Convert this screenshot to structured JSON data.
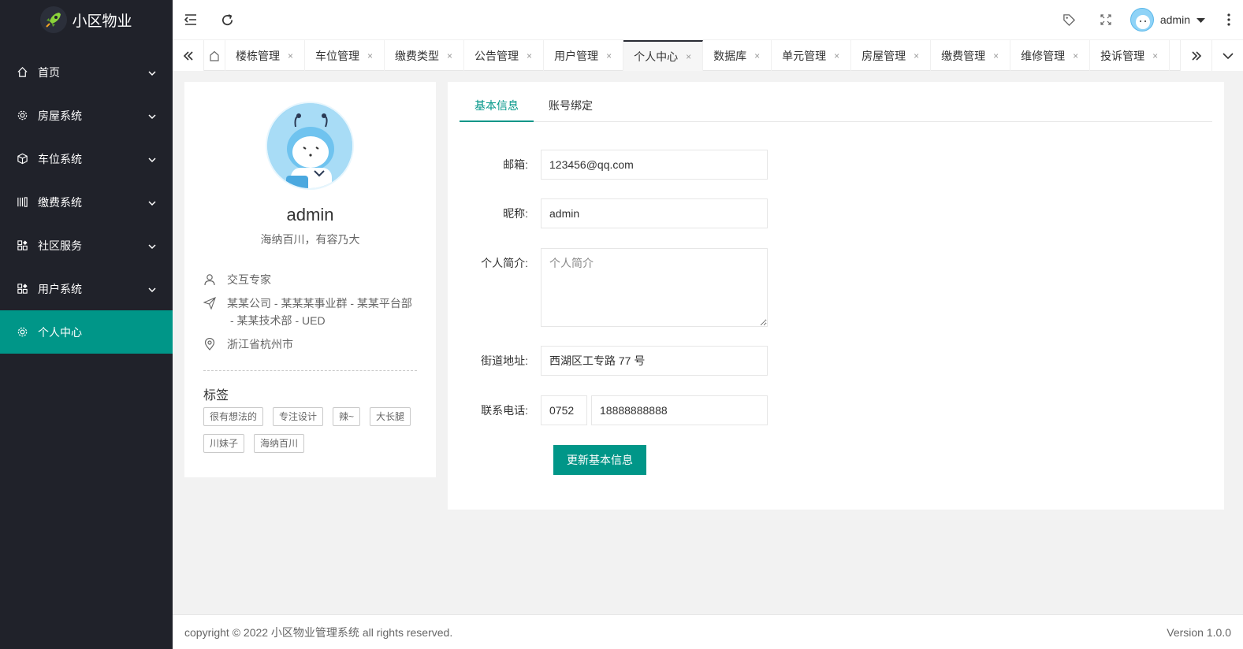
{
  "app": {
    "title": "小区物业"
  },
  "sidebar": {
    "items": [
      {
        "label": "首页",
        "icon": "home-icon"
      },
      {
        "label": "房屋系统",
        "icon": "gear-icon"
      },
      {
        "label": "车位系统",
        "icon": "box-icon"
      },
      {
        "label": "缴费系统",
        "icon": "receipt-icon"
      },
      {
        "label": "社区服务",
        "icon": "apps-icon"
      },
      {
        "label": "用户系统",
        "icon": "apps-icon"
      },
      {
        "label": "个人中心",
        "icon": "gear-icon",
        "active": true
      }
    ]
  },
  "header": {
    "username": "admin"
  },
  "tabs": [
    {
      "label": "楼栋管理"
    },
    {
      "label": "车位管理"
    },
    {
      "label": "缴费类型"
    },
    {
      "label": "公告管理"
    },
    {
      "label": "用户管理"
    },
    {
      "label": "个人中心",
      "active": true
    },
    {
      "label": "数据库"
    },
    {
      "label": "单元管理"
    },
    {
      "label": "房屋管理"
    },
    {
      "label": "缴费管理"
    },
    {
      "label": "维修管理"
    },
    {
      "label": "投诉管理"
    }
  ],
  "tab_close_glyph": "×",
  "profile": {
    "name": "admin",
    "motto": "海纳百川，有容乃大",
    "title": "交互专家",
    "org_line1": "某某公司 - 某某某事业群 - 某某平台部",
    "org_line2": "- 某某技术部 - UED",
    "location": "浙江省杭州市",
    "tags_title": "标签",
    "tags": [
      "很有想法的",
      "专注设计",
      "辣~",
      "大长腿",
      "川妹子",
      "海纳百川"
    ]
  },
  "form": {
    "tabs": [
      "基本信息",
      "账号绑定"
    ],
    "email_label": "邮箱:",
    "email_value": "123456@qq.com",
    "nickname_label": "昵称:",
    "nickname_value": "admin",
    "bio_label": "个人简介:",
    "bio_placeholder": "个人简介",
    "address_label": "街道地址:",
    "address_value": "西湖区工专路 77 号",
    "phone_label": "联系电话:",
    "phone_area": "0752",
    "phone_number": "18888888888",
    "submit_label": "更新基本信息"
  },
  "footer": {
    "copyright": "copyright © 2022 小区物业管理系统 all rights reserved.",
    "version": "Version 1.0.0"
  },
  "colors": {
    "accent": "#009688",
    "sidebar_bg": "#20222a"
  }
}
